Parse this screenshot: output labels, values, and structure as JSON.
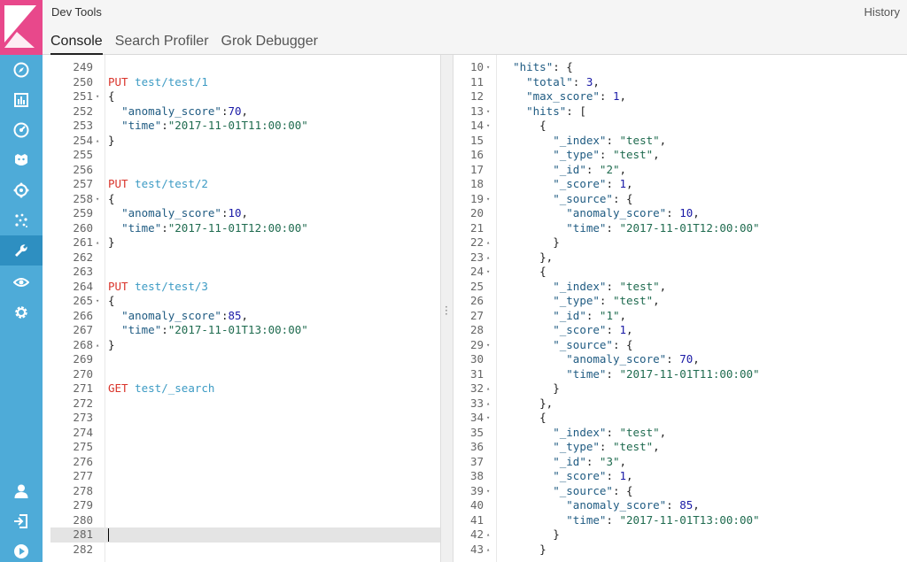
{
  "app": {
    "title": "Dev Tools",
    "history_label": "History"
  },
  "tabs": [
    {
      "label": "Console",
      "active": true
    },
    {
      "label": "Search Profiler",
      "active": false
    },
    {
      "label": "Grok Debugger",
      "active": false
    }
  ],
  "colors": {
    "sidebar": "#4eabd8",
    "logo_bg": "#e8488b",
    "method": "#d9342b",
    "url": "#3d9bc4",
    "key": "#1f5b82",
    "number": "#1a1aa6",
    "string": "#1f6b4f"
  },
  "sidebar": {
    "top_icons": [
      "discover-compass-icon",
      "visualize-chart-icon",
      "dashboard-icon",
      "timelion-icon",
      "machine-learning-icon",
      "graph-icon",
      "dev-tools-wrench-icon",
      "monitoring-eye-icon",
      "management-gear-icon"
    ],
    "bottom_icons": [
      "user-icon",
      "logout-icon",
      "collapse-play-icon"
    ]
  },
  "request_editor": {
    "current_line": 281,
    "lines": [
      {
        "n": "249",
        "fold": "",
        "t": []
      },
      {
        "n": "250",
        "fold": "",
        "t": [
          [
            "m",
            "PUT"
          ],
          [
            "p",
            " "
          ],
          [
            "u",
            "test/test/1"
          ]
        ]
      },
      {
        "n": "251",
        "fold": "▾",
        "t": [
          [
            "p",
            "{"
          ]
        ]
      },
      {
        "n": "252",
        "fold": "",
        "t": [
          [
            "p",
            "  "
          ],
          [
            "k",
            "\"anomaly_score\""
          ],
          [
            "p",
            ":"
          ],
          [
            "n",
            "70"
          ],
          [
            "p",
            ","
          ]
        ]
      },
      {
        "n": "253",
        "fold": "",
        "t": [
          [
            "p",
            "  "
          ],
          [
            "k",
            "\"time\""
          ],
          [
            "p",
            ":"
          ],
          [
            "s",
            "\"2017-11-01T11:00:00\""
          ]
        ]
      },
      {
        "n": "254",
        "fold": "▴",
        "t": [
          [
            "p",
            "}"
          ]
        ]
      },
      {
        "n": "255",
        "fold": "",
        "t": []
      },
      {
        "n": "256",
        "fold": "",
        "t": []
      },
      {
        "n": "257",
        "fold": "",
        "t": [
          [
            "m",
            "PUT"
          ],
          [
            "p",
            " "
          ],
          [
            "u",
            "test/test/2"
          ]
        ]
      },
      {
        "n": "258",
        "fold": "▾",
        "t": [
          [
            "p",
            "{"
          ]
        ]
      },
      {
        "n": "259",
        "fold": "",
        "t": [
          [
            "p",
            "  "
          ],
          [
            "k",
            "\"anomaly_score\""
          ],
          [
            "p",
            ":"
          ],
          [
            "n",
            "10"
          ],
          [
            "p",
            ","
          ]
        ]
      },
      {
        "n": "260",
        "fold": "",
        "t": [
          [
            "p",
            "  "
          ],
          [
            "k",
            "\"time\""
          ],
          [
            "p",
            ":"
          ],
          [
            "s",
            "\"2017-11-01T12:00:00\""
          ]
        ]
      },
      {
        "n": "261",
        "fold": "▴",
        "t": [
          [
            "p",
            "}"
          ]
        ]
      },
      {
        "n": "262",
        "fold": "",
        "t": []
      },
      {
        "n": "263",
        "fold": "",
        "t": []
      },
      {
        "n": "264",
        "fold": "",
        "t": [
          [
            "m",
            "PUT"
          ],
          [
            "p",
            " "
          ],
          [
            "u",
            "test/test/3"
          ]
        ]
      },
      {
        "n": "265",
        "fold": "▾",
        "t": [
          [
            "p",
            "{"
          ]
        ]
      },
      {
        "n": "266",
        "fold": "",
        "t": [
          [
            "p",
            "  "
          ],
          [
            "k",
            "\"anomaly_score\""
          ],
          [
            "p",
            ":"
          ],
          [
            "n",
            "85"
          ],
          [
            "p",
            ","
          ]
        ]
      },
      {
        "n": "267",
        "fold": "",
        "t": [
          [
            "p",
            "  "
          ],
          [
            "k",
            "\"time\""
          ],
          [
            "p",
            ":"
          ],
          [
            "s",
            "\"2017-11-01T13:00:00\""
          ]
        ]
      },
      {
        "n": "268",
        "fold": "▴",
        "t": [
          [
            "p",
            "}"
          ]
        ]
      },
      {
        "n": "269",
        "fold": "",
        "t": []
      },
      {
        "n": "270",
        "fold": "",
        "t": []
      },
      {
        "n": "271",
        "fold": "",
        "t": [
          [
            "m",
            "GET"
          ],
          [
            "p",
            " "
          ],
          [
            "u",
            "test/_search"
          ]
        ]
      },
      {
        "n": "272",
        "fold": "",
        "t": []
      },
      {
        "n": "273",
        "fold": "",
        "t": []
      },
      {
        "n": "274",
        "fold": "",
        "t": []
      },
      {
        "n": "275",
        "fold": "",
        "t": []
      },
      {
        "n": "276",
        "fold": "",
        "t": []
      },
      {
        "n": "277",
        "fold": "",
        "t": []
      },
      {
        "n": "278",
        "fold": "",
        "t": []
      },
      {
        "n": "279",
        "fold": "",
        "t": []
      },
      {
        "n": "280",
        "fold": "",
        "t": []
      },
      {
        "n": "281",
        "fold": "",
        "t": []
      },
      {
        "n": "282",
        "fold": "",
        "t": []
      }
    ]
  },
  "response_viewer": {
    "lines": [
      {
        "n": "10",
        "fold": "▾",
        "t": [
          [
            "p",
            "  "
          ],
          [
            "k",
            "\"hits\""
          ],
          [
            "p",
            ": {"
          ]
        ]
      },
      {
        "n": "11",
        "fold": "",
        "t": [
          [
            "p",
            "    "
          ],
          [
            "k",
            "\"total\""
          ],
          [
            "p",
            ": "
          ],
          [
            "n",
            "3"
          ],
          [
            "p",
            ","
          ]
        ]
      },
      {
        "n": "12",
        "fold": "",
        "t": [
          [
            "p",
            "    "
          ],
          [
            "k",
            "\"max_score\""
          ],
          [
            "p",
            ": "
          ],
          [
            "n",
            "1"
          ],
          [
            "p",
            ","
          ]
        ]
      },
      {
        "n": "13",
        "fold": "▾",
        "t": [
          [
            "p",
            "    "
          ],
          [
            "k",
            "\"hits\""
          ],
          [
            "p",
            ": ["
          ]
        ]
      },
      {
        "n": "14",
        "fold": "▾",
        "t": [
          [
            "p",
            "      {"
          ]
        ]
      },
      {
        "n": "15",
        "fold": "",
        "t": [
          [
            "p",
            "        "
          ],
          [
            "k",
            "\"_index\""
          ],
          [
            "p",
            ": "
          ],
          [
            "s",
            "\"test\""
          ],
          [
            "p",
            ","
          ]
        ]
      },
      {
        "n": "16",
        "fold": "",
        "t": [
          [
            "p",
            "        "
          ],
          [
            "k",
            "\"_type\""
          ],
          [
            "p",
            ": "
          ],
          [
            "s",
            "\"test\""
          ],
          [
            "p",
            ","
          ]
        ]
      },
      {
        "n": "17",
        "fold": "",
        "t": [
          [
            "p",
            "        "
          ],
          [
            "k",
            "\"_id\""
          ],
          [
            "p",
            ": "
          ],
          [
            "s",
            "\"2\""
          ],
          [
            "p",
            ","
          ]
        ]
      },
      {
        "n": "18",
        "fold": "",
        "t": [
          [
            "p",
            "        "
          ],
          [
            "k",
            "\"_score\""
          ],
          [
            "p",
            ": "
          ],
          [
            "n",
            "1"
          ],
          [
            "p",
            ","
          ]
        ]
      },
      {
        "n": "19",
        "fold": "▾",
        "t": [
          [
            "p",
            "        "
          ],
          [
            "k",
            "\"_source\""
          ],
          [
            "p",
            ": {"
          ]
        ]
      },
      {
        "n": "20",
        "fold": "",
        "t": [
          [
            "p",
            "          "
          ],
          [
            "k",
            "\"anomaly_score\""
          ],
          [
            "p",
            ": "
          ],
          [
            "n",
            "10"
          ],
          [
            "p",
            ","
          ]
        ]
      },
      {
        "n": "21",
        "fold": "",
        "t": [
          [
            "p",
            "          "
          ],
          [
            "k",
            "\"time\""
          ],
          [
            "p",
            ": "
          ],
          [
            "s",
            "\"2017-11-01T12:00:00\""
          ]
        ]
      },
      {
        "n": "22",
        "fold": "▴",
        "t": [
          [
            "p",
            "        }"
          ]
        ]
      },
      {
        "n": "23",
        "fold": "▴",
        "t": [
          [
            "p",
            "      },"
          ]
        ]
      },
      {
        "n": "24",
        "fold": "▾",
        "t": [
          [
            "p",
            "      {"
          ]
        ]
      },
      {
        "n": "25",
        "fold": "",
        "t": [
          [
            "p",
            "        "
          ],
          [
            "k",
            "\"_index\""
          ],
          [
            "p",
            ": "
          ],
          [
            "s",
            "\"test\""
          ],
          [
            "p",
            ","
          ]
        ]
      },
      {
        "n": "26",
        "fold": "",
        "t": [
          [
            "p",
            "        "
          ],
          [
            "k",
            "\"_type\""
          ],
          [
            "p",
            ": "
          ],
          [
            "s",
            "\"test\""
          ],
          [
            "p",
            ","
          ]
        ]
      },
      {
        "n": "27",
        "fold": "",
        "t": [
          [
            "p",
            "        "
          ],
          [
            "k",
            "\"_id\""
          ],
          [
            "p",
            ": "
          ],
          [
            "s",
            "\"1\""
          ],
          [
            "p",
            ","
          ]
        ]
      },
      {
        "n": "28",
        "fold": "",
        "t": [
          [
            "p",
            "        "
          ],
          [
            "k",
            "\"_score\""
          ],
          [
            "p",
            ": "
          ],
          [
            "n",
            "1"
          ],
          [
            "p",
            ","
          ]
        ]
      },
      {
        "n": "29",
        "fold": "▾",
        "t": [
          [
            "p",
            "        "
          ],
          [
            "k",
            "\"_source\""
          ],
          [
            "p",
            ": {"
          ]
        ]
      },
      {
        "n": "30",
        "fold": "",
        "t": [
          [
            "p",
            "          "
          ],
          [
            "k",
            "\"anomaly_score\""
          ],
          [
            "p",
            ": "
          ],
          [
            "n",
            "70"
          ],
          [
            "p",
            ","
          ]
        ]
      },
      {
        "n": "31",
        "fold": "",
        "t": [
          [
            "p",
            "          "
          ],
          [
            "k",
            "\"time\""
          ],
          [
            "p",
            ": "
          ],
          [
            "s",
            "\"2017-11-01T11:00:00\""
          ]
        ]
      },
      {
        "n": "32",
        "fold": "▴",
        "t": [
          [
            "p",
            "        }"
          ]
        ]
      },
      {
        "n": "33",
        "fold": "▴",
        "t": [
          [
            "p",
            "      },"
          ]
        ]
      },
      {
        "n": "34",
        "fold": "▾",
        "t": [
          [
            "p",
            "      {"
          ]
        ]
      },
      {
        "n": "35",
        "fold": "",
        "t": [
          [
            "p",
            "        "
          ],
          [
            "k",
            "\"_index\""
          ],
          [
            "p",
            ": "
          ],
          [
            "s",
            "\"test\""
          ],
          [
            "p",
            ","
          ]
        ]
      },
      {
        "n": "36",
        "fold": "",
        "t": [
          [
            "p",
            "        "
          ],
          [
            "k",
            "\"_type\""
          ],
          [
            "p",
            ": "
          ],
          [
            "s",
            "\"test\""
          ],
          [
            "p",
            ","
          ]
        ]
      },
      {
        "n": "37",
        "fold": "",
        "t": [
          [
            "p",
            "        "
          ],
          [
            "k",
            "\"_id\""
          ],
          [
            "p",
            ": "
          ],
          [
            "s",
            "\"3\""
          ],
          [
            "p",
            ","
          ]
        ]
      },
      {
        "n": "38",
        "fold": "",
        "t": [
          [
            "p",
            "        "
          ],
          [
            "k",
            "\"_score\""
          ],
          [
            "p",
            ": "
          ],
          [
            "n",
            "1"
          ],
          [
            "p",
            ","
          ]
        ]
      },
      {
        "n": "39",
        "fold": "▾",
        "t": [
          [
            "p",
            "        "
          ],
          [
            "k",
            "\"_source\""
          ],
          [
            "p",
            ": {"
          ]
        ]
      },
      {
        "n": "40",
        "fold": "",
        "t": [
          [
            "p",
            "          "
          ],
          [
            "k",
            "\"anomaly_score\""
          ],
          [
            "p",
            ": "
          ],
          [
            "n",
            "85"
          ],
          [
            "p",
            ","
          ]
        ]
      },
      {
        "n": "41",
        "fold": "",
        "t": [
          [
            "p",
            "          "
          ],
          [
            "k",
            "\"time\""
          ],
          [
            "p",
            ": "
          ],
          [
            "s",
            "\"2017-11-01T13:00:00\""
          ]
        ]
      },
      {
        "n": "42",
        "fold": "▴",
        "t": [
          [
            "p",
            "        }"
          ]
        ]
      },
      {
        "n": "43",
        "fold": "▴",
        "t": [
          [
            "p",
            "      }"
          ]
        ]
      }
    ]
  }
}
